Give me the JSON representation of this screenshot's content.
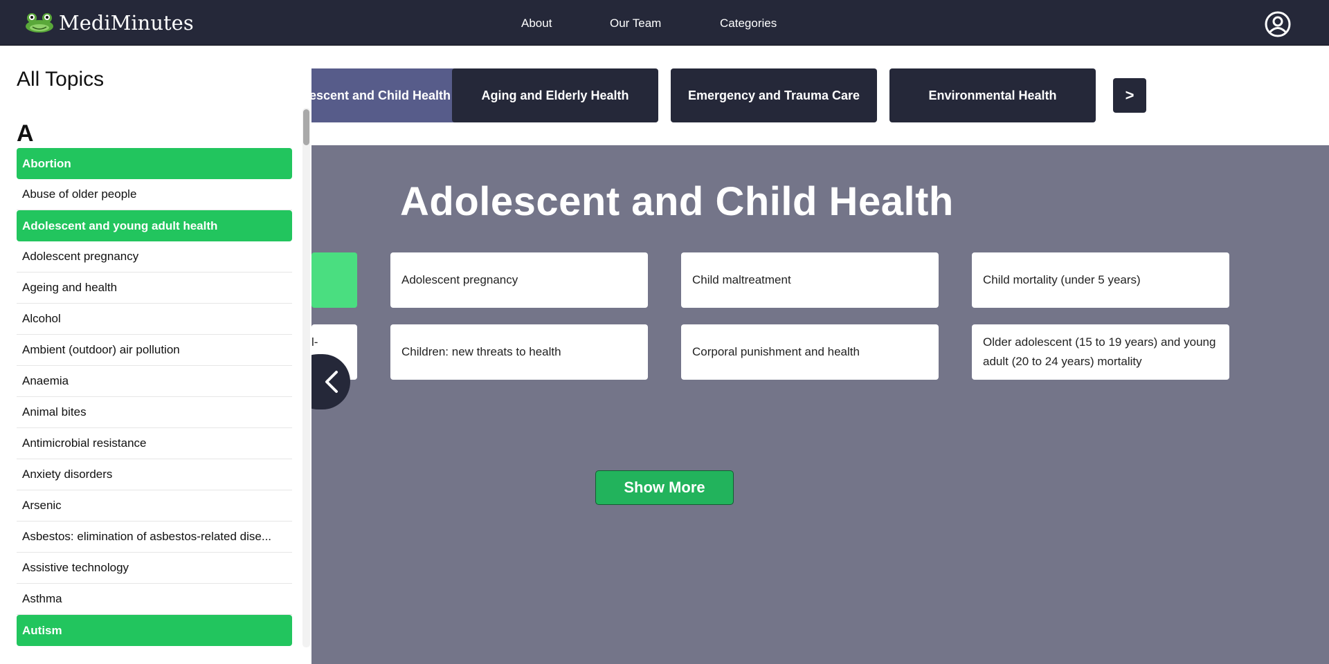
{
  "header": {
    "brand": "MediMinutes",
    "nav": [
      "About",
      "Our Team",
      "Categories"
    ]
  },
  "tabs": {
    "items": [
      "Adolescent and Child Health",
      "Aging and Elderly Health",
      "Emergency and Trauma Care",
      "Environmental Health"
    ],
    "active_index": 0,
    "next_label": ">"
  },
  "section": {
    "title": "Adolescent and Child Health",
    "cards": [
      "",
      "Adolescent pregnancy",
      "Child maltreatment",
      "Child mortality (under 5 years)",
      "l-",
      "Children: new threats to health",
      "Corporal punishment and health",
      "Older adolescent (15 to 19 years) and young adult (20 to 24 years) mortality"
    ],
    "show_more": "Show More"
  },
  "sidebar": {
    "title": "All Topics",
    "letter": "A",
    "topics": [
      {
        "label": "Abortion",
        "highlighted": true
      },
      {
        "label": "Abuse of older people",
        "highlighted": false
      },
      {
        "label": "Adolescent and young adult health",
        "highlighted": true
      },
      {
        "label": "Adolescent pregnancy",
        "highlighted": false
      },
      {
        "label": "Ageing and health",
        "highlighted": false
      },
      {
        "label": "Alcohol",
        "highlighted": false
      },
      {
        "label": "Ambient (outdoor) air pollution",
        "highlighted": false
      },
      {
        "label": "Anaemia",
        "highlighted": false
      },
      {
        "label": "Animal bites",
        "highlighted": false
      },
      {
        "label": "Antimicrobial resistance",
        "highlighted": false
      },
      {
        "label": "Anxiety disorders",
        "highlighted": false
      },
      {
        "label": "Arsenic",
        "highlighted": false
      },
      {
        "label": "Asbestos: elimination of asbestos-related dise...",
        "highlighted": false
      },
      {
        "label": "Assistive technology",
        "highlighted": false
      },
      {
        "label": "Asthma",
        "highlighted": false
      },
      {
        "label": "Autism",
        "highlighted": true
      }
    ]
  },
  "colors": {
    "header_bg": "#252839",
    "accent_green": "#22c55e",
    "light_green": "#4ade80",
    "active_tab": "#575c8a",
    "content_bg": "#747589"
  },
  "icons": {
    "logo": "frog-logo-icon",
    "profile": "user-circle-icon",
    "prev": "chevron-left-icon"
  }
}
